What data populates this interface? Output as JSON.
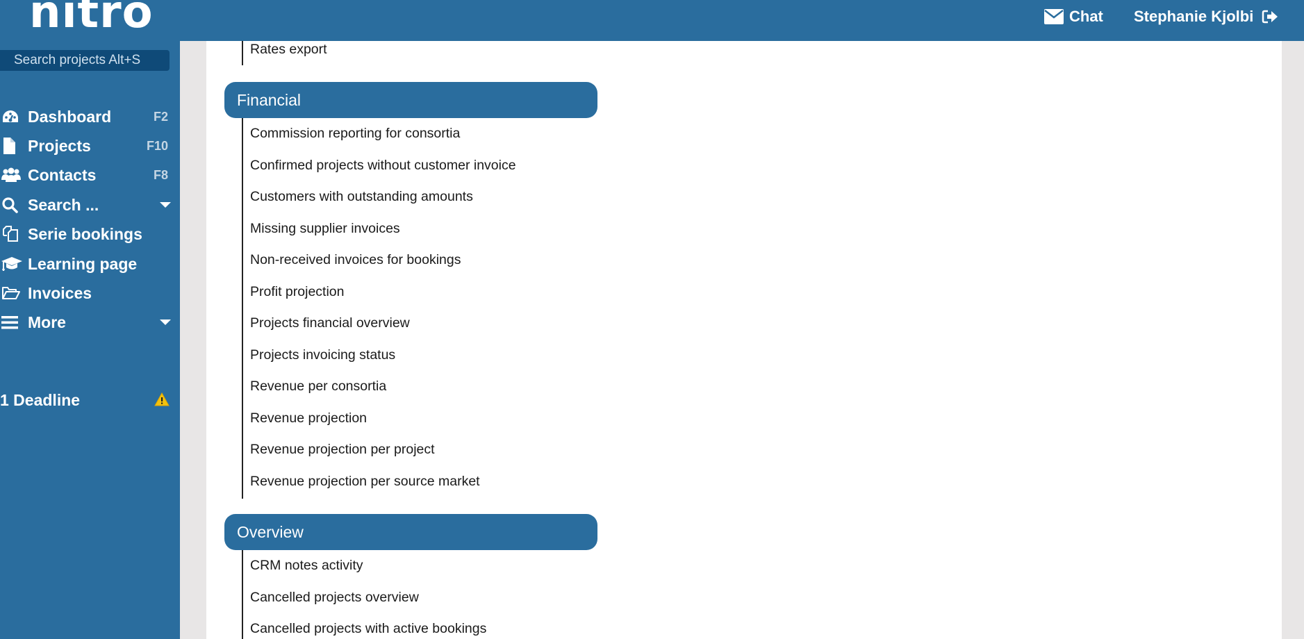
{
  "header": {
    "logo": "nitro",
    "chat_label": "Chat",
    "user_name": "Stephanie Kjolbi"
  },
  "sidebar": {
    "search_placeholder": "Search projects Alt+S",
    "items": [
      {
        "label": "Dashboard",
        "shortcut": "F2",
        "icon": "dashboard-icon"
      },
      {
        "label": "Projects",
        "shortcut": "F10",
        "icon": "file-icon"
      },
      {
        "label": "Contacts",
        "shortcut": "F8",
        "icon": "users-icon"
      },
      {
        "label": "Search ...",
        "shortcut": "",
        "icon": "search-icon",
        "dropdown": true
      },
      {
        "label": "Serie bookings",
        "shortcut": "",
        "icon": "copy-icon"
      },
      {
        "label": "Learning page",
        "shortcut": "",
        "icon": "graduation-cap-icon"
      },
      {
        "label": "Invoices",
        "shortcut": "",
        "icon": "folder-open-icon"
      },
      {
        "label": "More",
        "shortcut": "",
        "icon": "menu-icon",
        "dropdown": true
      }
    ],
    "deadline_label": "1 Deadline"
  },
  "main": {
    "previous_section_tail": [
      "Rates export"
    ],
    "sections": [
      {
        "title": "Financial",
        "reports": [
          "Commission reporting for consortia",
          "Confirmed projects without customer invoice",
          "Customers with outstanding amounts",
          "Missing supplier invoices",
          "Non-received invoices for bookings",
          "Profit projection",
          "Projects financial overview",
          "Projects invoicing status",
          "Revenue per consortia",
          "Revenue projection",
          "Revenue projection per project",
          "Revenue projection per source market"
        ]
      },
      {
        "title": "Overview",
        "reports": [
          "CRM notes activity",
          "Cancelled projects overview",
          "Cancelled projects with active bookings"
        ]
      }
    ]
  },
  "colors": {
    "brand_blue": "#2a6d9e",
    "search_bg": "#0f4a78",
    "gutter_grey": "#e8e6e6",
    "warning_yellow": "#f4c20d"
  }
}
